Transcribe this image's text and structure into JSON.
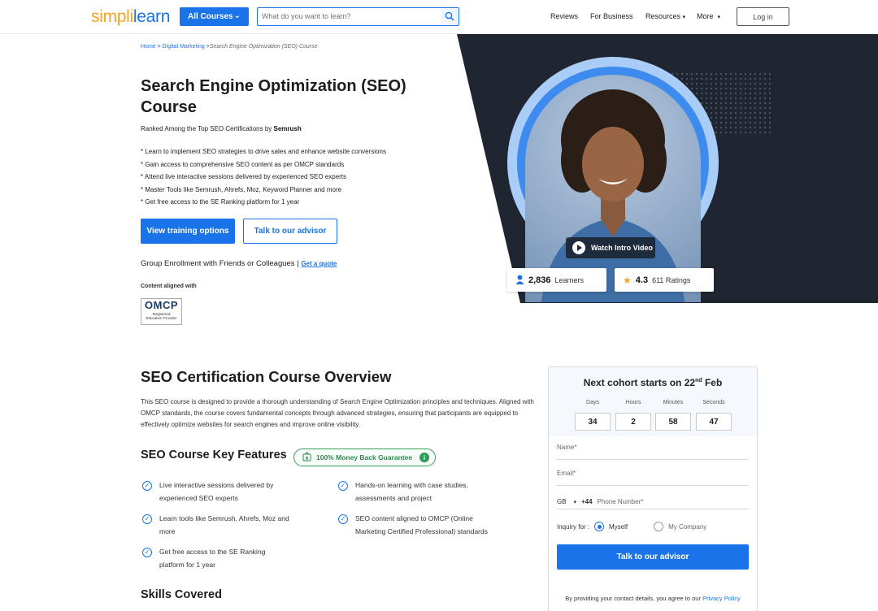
{
  "header": {
    "logo": {
      "part1": "simpl",
      "part2": "i",
      "part3": "learn"
    },
    "all_courses": "All Courses",
    "search_placeholder": "What do you want to learn?",
    "nav": {
      "reviews": "Reviews",
      "business": "For Business",
      "resources": "Resources",
      "more": "More"
    },
    "login": "Log in"
  },
  "breadcrumb": {
    "home": "Home",
    "sep1": " > ",
    "cat": "Digital Marketing",
    "sep2": " >",
    "current": "Search Engine Optimization (SEO) Course"
  },
  "hero": {
    "title": "Search Engine Optimization (SEO) Course",
    "ranked_prefix": "Ranked Among the Top SEO Certifications by ",
    "ranked_brand": "Semrush",
    "bullets": [
      "* Learn to implement SEO strategies to drive sales and enhance website conversions",
      "* Gain access to comprehensive SEO content as per OMCP standards",
      "* Attend live interactive sessions delivered by experienced SEO experts",
      "* Master Tools like Semrush, Ahrefs, Moz, Keyword Planner and more",
      "* Get free access to the SE Ranking platform for 1 year"
    ],
    "btn_primary": "View training options",
    "btn_outline": "Talk to our advisor",
    "group_text": "Group Enrollment with Friends or Colleagues | ",
    "group_link": "Get a quote",
    "aligned_label": "Content aligned with",
    "omcp_big": "OMCP",
    "omcp_small1": "Registered",
    "omcp_small2": "Education Provider",
    "watch_video": "Watch Intro Video",
    "learners_count": "2,836",
    "learners_label": "Learners",
    "rating": "4.3",
    "ratings_label": "611 Ratings"
  },
  "overview": {
    "title_plain": "SEO Certification Course ",
    "title_bold": "Overview",
    "text": "This SEO course is designed to provide a thorough understanding of Search Engine Optimization principles and techniques. Aligned with OMCP standards, the course covers fundamental concepts through advanced strategies, ensuring that participants are equipped to effectively optimize websites for search engines and improve online visibility.",
    "key_features_title": "SEO Course Key Features",
    "money_back": "100% Money Back Guarantee",
    "features": [
      "Live interactive sessions delivered by experienced SEO experts",
      "Hands-on learning with case studies, assessments and project",
      "Learn tools like Semrush, Ahrefs, Moz and more",
      "SEO content aligned to OMCP (Online Marketing Certified Professional) standards",
      "Get free access to the SE Ranking platform for 1 year"
    ],
    "skills_title": "Skills Covered"
  },
  "form": {
    "cohort_prefix": "Next cohort starts on 22",
    "cohort_sup": "nd",
    "cohort_suffix": " Feb",
    "countdown": [
      {
        "label": "Days",
        "value": "34"
      },
      {
        "label": "Hours",
        "value": "2"
      },
      {
        "label": "Minutes",
        "value": "58"
      },
      {
        "label": "Seconds",
        "value": "47"
      }
    ],
    "name_placeholder": "Name*",
    "email_placeholder": "Email*",
    "country": "GB",
    "dial_code": "+44",
    "phone_placeholder": "Phone Number*",
    "inquiry_label": "Inquiry for :",
    "opt_myself": "Myself",
    "opt_company": "My Company",
    "submit": "Talk to our advisor",
    "disclaimer": "By providing your contact details, you agree to our ",
    "privacy": "Privacy Policy"
  },
  "colors": {
    "brand_blue": "#1a73e8",
    "brand_orange": "#f7a41d",
    "hero_dark": "#1f2631",
    "guarantee_green": "#2e8b4f"
  }
}
